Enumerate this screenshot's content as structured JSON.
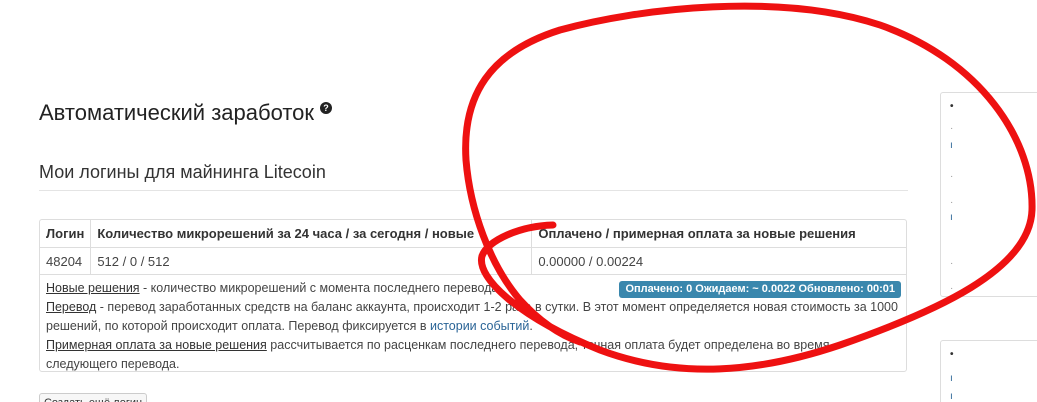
{
  "header": {
    "title": "Автоматический заработок",
    "help_icon": "question-circle-icon"
  },
  "logins": {
    "title": "Мои логины для майнинга Litecoin",
    "columns": [
      "Логин",
      "Количество микрорешений за 24 часа / за сегодня / новые",
      "Оплачено / примерная оплата за новые решения"
    ],
    "rows": [
      [
        "48204",
        "512 / 0 / 512",
        "0.00000 / 0.00224"
      ]
    ],
    "status_badge": "Оплачено: 0 Ожидаем: ~ 0.0022 Обновлено: 00:01",
    "notes": {
      "new_solutions_term": "Новые решения",
      "new_solutions_text": " - количество микрорешений с момента последнего перевода.",
      "transfer_term": "Перевод",
      "transfer_text": " - перевод заработанных средств на баланс аккаунта, происходит 1-2 раза в сутки. В этот момент определяется новая стоимость за 1000 решений, по которой происходит оплата. Перевод фиксируется в ",
      "history_link": "истории событий",
      "history_suffix": ".",
      "estimated_term": "Примерная оплата за новые решения",
      "estimated_text": " рассчитывается по расценкам последнего перевода, точная оплата будет определена во время следующего перевода."
    },
    "create_button": "Создать ещё логин"
  },
  "colors": {
    "badge": "#3a87ad",
    "link": "#2a6496",
    "annotation": "#ee1111"
  }
}
